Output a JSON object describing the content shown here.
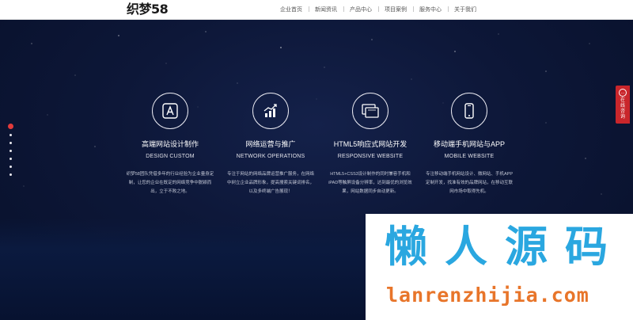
{
  "header": {
    "logo": "织梦58",
    "nav": [
      "企业首页",
      "新闻资讯",
      "产品中心",
      "项目案例",
      "服务中心",
      "关于我们"
    ]
  },
  "features": [
    {
      "icon": "app-store-icon",
      "title": "高端网站设计制作",
      "subtitle": "DESIGN CUSTOM",
      "desc": "织梦58团队凭借多年的行业经验为企业量身定制，让您的企业在既定的网络竞争中脱颖而出，立于不败之地。"
    },
    {
      "icon": "growth-chart-icon",
      "title": "网络运营与推广",
      "subtitle": "NETWORK OPERATIONS",
      "desc": "专注于网站的网络品牌运营推广服务，在网络中树立企业品牌形象，提高搜索关键词排名，以及多终端广告展现！"
    },
    {
      "icon": "responsive-screens-icon",
      "title": "HTML5响应式网站开发",
      "subtitle": "RESPONSIVE WEBSITE",
      "desc": "HTML5+CSS3设计制作的同时兼容手机和iPAD等触屏设备分辨率，达到最优的浏览效果，网站数据同步自动更新。"
    },
    {
      "icon": "smartphone-icon",
      "title": "移动端手机网站与APP",
      "subtitle": "MOBILE WEBSITE",
      "desc": "专注移动端手机网站设计、微网站、手机APP定制开发，找准有效的品牌网站，在移动互联网市场中取得先机。"
    }
  ],
  "pagination": {
    "count": 7,
    "active": 0
  },
  "side_tab": {
    "icon": "qq-chat-icon",
    "label": "在线咨询"
  },
  "watermark": {
    "cn": "懒人源码",
    "en": "lanrenzhijia.com"
  },
  "colors": {
    "accent_red": "#e23b3b",
    "watermark_blue": "#2aa7e0",
    "watermark_orange": "#e8752a",
    "hero_bg": "#0a1330"
  }
}
